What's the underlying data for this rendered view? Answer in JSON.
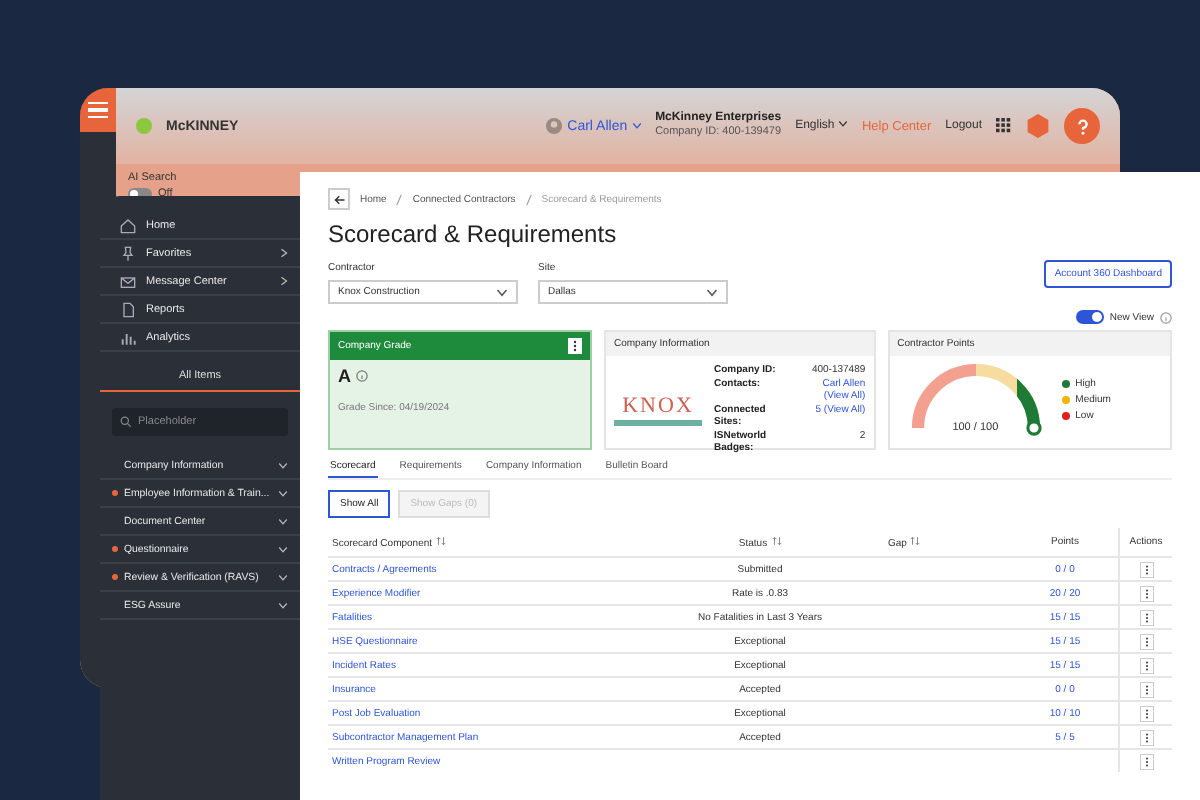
{
  "header": {
    "logo": "McKINNEY",
    "user": "Carl Allen",
    "company_name": "McKinney Enterprises",
    "company_id": "Company ID: 400-139479",
    "language": "English",
    "help": "Help Center",
    "logout": "Logout"
  },
  "search_bar": {
    "label": "AI Search",
    "toggle": {
      "label": "Off",
      "on": false
    }
  },
  "sidebar": {
    "nav": [
      {
        "label": "Home",
        "submenu": false
      },
      {
        "label": "Favorites",
        "submenu": true
      },
      {
        "label": "Message Center",
        "submenu": true
      },
      {
        "label": "Reports",
        "submenu": false
      },
      {
        "label": "Analytics",
        "submenu": false
      }
    ],
    "section_title": "All Items",
    "search": {
      "placeholder": "Placeholder"
    },
    "sections": [
      {
        "label": "Company Information",
        "flagged": false
      },
      {
        "label": "Employee Information & Train...",
        "flagged": true
      },
      {
        "label": "Document Center",
        "flagged": false
      },
      {
        "label": "Questionnaire",
        "flagged": true
      },
      {
        "label": "Review & Verification (RAVS)",
        "flagged": true
      },
      {
        "label": "ESG Assure",
        "flagged": false
      }
    ]
  },
  "main": {
    "breadcrumbs": [
      "Home",
      "Connected Contractors",
      "Scorecard & Requirements"
    ],
    "title": "Scorecard & Requirements",
    "contractor": {
      "label": "Contractor",
      "value": "Knox Construction"
    },
    "site": {
      "label": "Site",
      "value": "Dallas"
    },
    "dashboard_button": "Account 360 Dashboard",
    "new_view": {
      "label": "New View",
      "on": true
    },
    "grade_card": {
      "title": "Company Grade",
      "grade": "A",
      "since": "Grade Since: 04/19/2024"
    },
    "company_info": {
      "title": "Company Information",
      "logo_text": "KNOX",
      "fields": [
        {
          "label": "Company ID:",
          "value": "400-137489",
          "link": false
        },
        {
          "label": "Contacts:",
          "value": "Carl Allen (View All)",
          "link": true
        },
        {
          "label": "Connected Sites:",
          "value": "5 (View All)",
          "link": true
        },
        {
          "label": "ISNetworld Badges:",
          "value": "2",
          "link": false
        }
      ]
    },
    "points": {
      "title": "Contractor Points",
      "reading": "100 / 100",
      "level": 1,
      "legend": [
        {
          "label": "High",
          "color": "#1e7a34"
        },
        {
          "label": "Medium",
          "color": "#f5b400"
        },
        {
          "label": "Low",
          "color": "#e02020"
        }
      ]
    },
    "tabs": [
      {
        "label": "Scorecard",
        "selected": true
      },
      {
        "label": "Requirements",
        "selected": false
      },
      {
        "label": "Company Information",
        "selected": false
      },
      {
        "label": "Bulletin Board",
        "selected": false
      }
    ],
    "filters": [
      {
        "label": "Show All",
        "selected": true
      },
      {
        "label": "Show Gaps (0)",
        "selected": false
      }
    ],
    "table": {
      "columns": [
        "Scorecard Component",
        "Status",
        "Gap",
        "Points",
        "Actions"
      ],
      "rows": [
        {
          "component": "Contracts / Agreements",
          "status": "Submitted",
          "points": "0 / 0"
        },
        {
          "component": "Experience Modifier",
          "status": "Rate is .0.83",
          "points": "20 / 20"
        },
        {
          "component": "Fatalities",
          "status": "No Fatalities in Last 3 Years",
          "points": "15 / 15"
        },
        {
          "component": "HSE Questionnaire",
          "status": "Exceptional",
          "points": "15 / 15"
        },
        {
          "component": "Incident Rates",
          "status": "Exceptional",
          "points": "15 / 15"
        },
        {
          "component": "Insurance",
          "status": "Accepted",
          "points": "0 / 0"
        },
        {
          "component": "Post Job Evaluation",
          "status": "Exceptional",
          "points": "10 / 10"
        },
        {
          "component": "Subcontractor Management Plan",
          "status": "Accepted",
          "points": "5 / 5"
        },
        {
          "component": "Written Program Review",
          "status": "",
          "points": ""
        }
      ]
    }
  }
}
